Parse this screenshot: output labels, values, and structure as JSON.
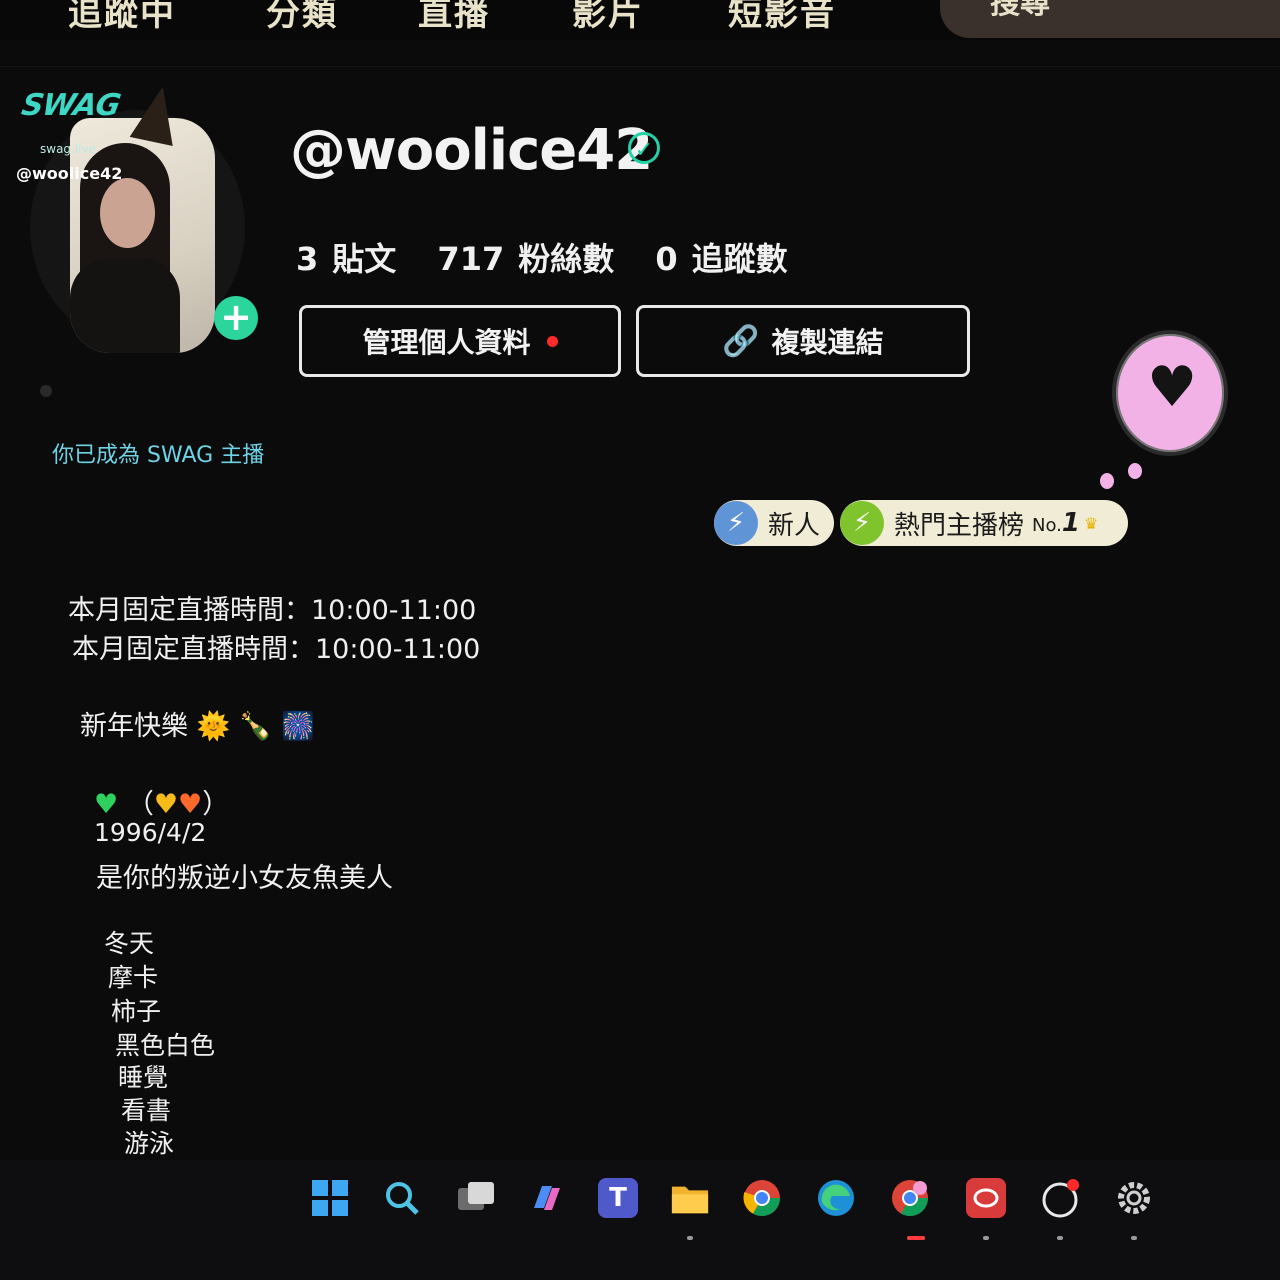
{
  "nav": {
    "items": [
      "追蹤中",
      "分類",
      "直播",
      "影片",
      "短影音"
    ],
    "search_label": "搜尋"
  },
  "watermark": {
    "logo": "SWAG",
    "site": "swag.live",
    "user": "@woolice42"
  },
  "profile": {
    "username": "@woolice42",
    "verified_mark": "✓",
    "stats": [
      {
        "value": "3",
        "label": "貼文"
      },
      {
        "value": "717",
        "label": "粉絲數"
      },
      {
        "value": "0",
        "label": "追蹤數"
      }
    ],
    "manage_button": "管理個人資料",
    "copy_link_button": "複製連結",
    "creator_note": "你已成為 SWAG 主播",
    "add_symbol": "+"
  },
  "badges": {
    "new_label": "新人",
    "hot_label": "熱門主播榜",
    "hot_rank_prefix": "No.",
    "hot_rank": "1"
  },
  "bio": {
    "line1": "本月固定直播時間：10:00-11:00",
    "line2": "本月固定直播時間：10:00-11:00",
    "new_year": "新年快樂",
    "new_year_emoji": "🌞 🍾 🎆",
    "hearts_green": "♥",
    "hearts_open": "（",
    "hearts_yellow": "♥",
    "hearts_orange": "♥",
    "hearts_close": "）",
    "birthday": "1996/4/2",
    "tagline": "是你的叛逆小女友魚美人",
    "likes": [
      "冬天",
      "摩卡",
      "柿子",
      "黑色白色",
      "睡覺",
      "看書",
      "游泳"
    ]
  },
  "taskbar": {
    "icons": [
      "windows-start",
      "search",
      "task-view",
      "copilot",
      "teams",
      "file-explorer",
      "chrome",
      "edge",
      "chrome-canary",
      "app-red",
      "app-line",
      "settings"
    ]
  },
  "colors": {
    "background": "#0b0b0c",
    "accent_green": "#2cd59b",
    "verified": "#22d1a6",
    "creator_note": "#6fd3e6",
    "badge_bg": "#f1ecd6",
    "bubble_pink": "#f3b2e6"
  }
}
